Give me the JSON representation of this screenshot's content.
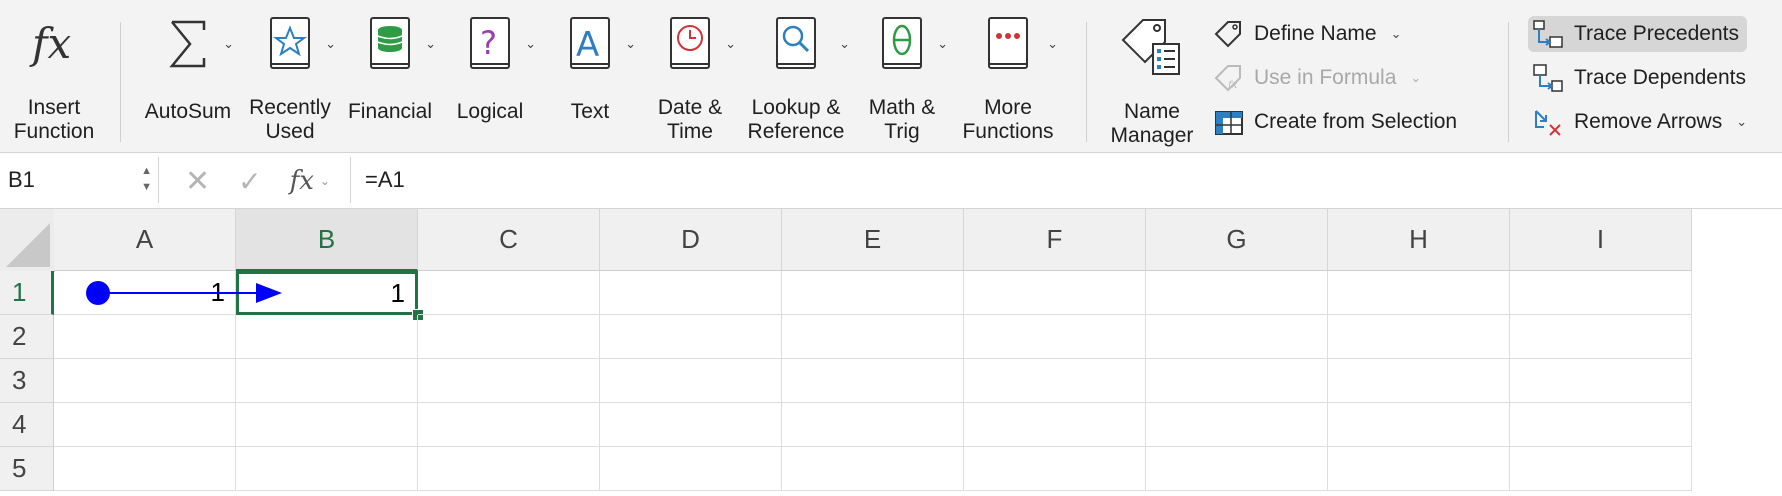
{
  "ribbon": {
    "insert_function": {
      "line1": "Insert",
      "line2": "Function"
    },
    "autosum": {
      "line1": "AutoSum",
      "line2": ""
    },
    "recently_used": {
      "line1": "Recently",
      "line2": "Used"
    },
    "financial": {
      "line1": "Financial",
      "line2": ""
    },
    "logical": {
      "line1": "Logical",
      "line2": ""
    },
    "text": {
      "line1": "Text",
      "line2": ""
    },
    "date_time": {
      "line1": "Date &",
      "line2": "Time"
    },
    "lookup": {
      "line1": "Lookup &",
      "line2": "Reference"
    },
    "math": {
      "line1": "Math &",
      "line2": "Trig"
    },
    "more": {
      "line1": "More",
      "line2": "Functions"
    },
    "name_manager": {
      "line1": "Name",
      "line2": "Manager"
    },
    "define_name": "Define Name",
    "use_in_formula": "Use in Formula",
    "create_from_selection": "Create from Selection",
    "trace_precedents": "Trace Precedents",
    "trace_dependents": "Trace Dependents",
    "remove_arrows": "Remove Arrows",
    "colors": {
      "star": "#2d7fc1",
      "db": "#2f9b45",
      "question": "#9a3fb0",
      "text_a": "#2d7fc1",
      "clock": "#d13438",
      "search": "#2d7fc1",
      "theta": "#2f9b45",
      "dots": "#d13438"
    }
  },
  "formula_bar": {
    "name_box": "B1",
    "formula": "=A1"
  },
  "grid": {
    "columns": [
      "A",
      "B",
      "C",
      "D",
      "E",
      "F",
      "G",
      "H",
      "I"
    ],
    "rows": [
      "1",
      "2",
      "3",
      "4",
      "5"
    ],
    "cells": {
      "A1": "1",
      "B1": "1"
    },
    "selected_cell": "B1",
    "accent": "#217346",
    "trace_arrow_color": "#0000ff"
  }
}
